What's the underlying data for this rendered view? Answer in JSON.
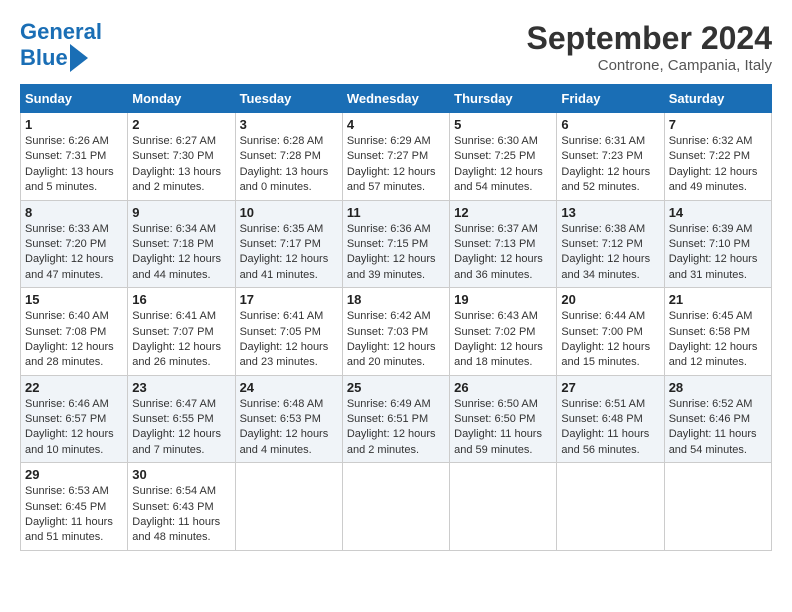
{
  "header": {
    "logo_line1": "General",
    "logo_line2": "Blue",
    "month": "September 2024",
    "location": "Controne, Campania, Italy"
  },
  "weekdays": [
    "Sunday",
    "Monday",
    "Tuesday",
    "Wednesday",
    "Thursday",
    "Friday",
    "Saturday"
  ],
  "weeks": [
    [
      {
        "day": "1",
        "lines": [
          "Sunrise: 6:26 AM",
          "Sunset: 7:31 PM",
          "Daylight: 13 hours",
          "and 5 minutes."
        ]
      },
      {
        "day": "2",
        "lines": [
          "Sunrise: 6:27 AM",
          "Sunset: 7:30 PM",
          "Daylight: 13 hours",
          "and 2 minutes."
        ]
      },
      {
        "day": "3",
        "lines": [
          "Sunrise: 6:28 AM",
          "Sunset: 7:28 PM",
          "Daylight: 13 hours",
          "and 0 minutes."
        ]
      },
      {
        "day": "4",
        "lines": [
          "Sunrise: 6:29 AM",
          "Sunset: 7:27 PM",
          "Daylight: 12 hours",
          "and 57 minutes."
        ]
      },
      {
        "day": "5",
        "lines": [
          "Sunrise: 6:30 AM",
          "Sunset: 7:25 PM",
          "Daylight: 12 hours",
          "and 54 minutes."
        ]
      },
      {
        "day": "6",
        "lines": [
          "Sunrise: 6:31 AM",
          "Sunset: 7:23 PM",
          "Daylight: 12 hours",
          "and 52 minutes."
        ]
      },
      {
        "day": "7",
        "lines": [
          "Sunrise: 6:32 AM",
          "Sunset: 7:22 PM",
          "Daylight: 12 hours",
          "and 49 minutes."
        ]
      }
    ],
    [
      {
        "day": "8",
        "lines": [
          "Sunrise: 6:33 AM",
          "Sunset: 7:20 PM",
          "Daylight: 12 hours",
          "and 47 minutes."
        ]
      },
      {
        "day": "9",
        "lines": [
          "Sunrise: 6:34 AM",
          "Sunset: 7:18 PM",
          "Daylight: 12 hours",
          "and 44 minutes."
        ]
      },
      {
        "day": "10",
        "lines": [
          "Sunrise: 6:35 AM",
          "Sunset: 7:17 PM",
          "Daylight: 12 hours",
          "and 41 minutes."
        ]
      },
      {
        "day": "11",
        "lines": [
          "Sunrise: 6:36 AM",
          "Sunset: 7:15 PM",
          "Daylight: 12 hours",
          "and 39 minutes."
        ]
      },
      {
        "day": "12",
        "lines": [
          "Sunrise: 6:37 AM",
          "Sunset: 7:13 PM",
          "Daylight: 12 hours",
          "and 36 minutes."
        ]
      },
      {
        "day": "13",
        "lines": [
          "Sunrise: 6:38 AM",
          "Sunset: 7:12 PM",
          "Daylight: 12 hours",
          "and 34 minutes."
        ]
      },
      {
        "day": "14",
        "lines": [
          "Sunrise: 6:39 AM",
          "Sunset: 7:10 PM",
          "Daylight: 12 hours",
          "and 31 minutes."
        ]
      }
    ],
    [
      {
        "day": "15",
        "lines": [
          "Sunrise: 6:40 AM",
          "Sunset: 7:08 PM",
          "Daylight: 12 hours",
          "and 28 minutes."
        ]
      },
      {
        "day": "16",
        "lines": [
          "Sunrise: 6:41 AM",
          "Sunset: 7:07 PM",
          "Daylight: 12 hours",
          "and 26 minutes."
        ]
      },
      {
        "day": "17",
        "lines": [
          "Sunrise: 6:41 AM",
          "Sunset: 7:05 PM",
          "Daylight: 12 hours",
          "and 23 minutes."
        ]
      },
      {
        "day": "18",
        "lines": [
          "Sunrise: 6:42 AM",
          "Sunset: 7:03 PM",
          "Daylight: 12 hours",
          "and 20 minutes."
        ]
      },
      {
        "day": "19",
        "lines": [
          "Sunrise: 6:43 AM",
          "Sunset: 7:02 PM",
          "Daylight: 12 hours",
          "and 18 minutes."
        ]
      },
      {
        "day": "20",
        "lines": [
          "Sunrise: 6:44 AM",
          "Sunset: 7:00 PM",
          "Daylight: 12 hours",
          "and 15 minutes."
        ]
      },
      {
        "day": "21",
        "lines": [
          "Sunrise: 6:45 AM",
          "Sunset: 6:58 PM",
          "Daylight: 12 hours",
          "and 12 minutes."
        ]
      }
    ],
    [
      {
        "day": "22",
        "lines": [
          "Sunrise: 6:46 AM",
          "Sunset: 6:57 PM",
          "Daylight: 12 hours",
          "and 10 minutes."
        ]
      },
      {
        "day": "23",
        "lines": [
          "Sunrise: 6:47 AM",
          "Sunset: 6:55 PM",
          "Daylight: 12 hours",
          "and 7 minutes."
        ]
      },
      {
        "day": "24",
        "lines": [
          "Sunrise: 6:48 AM",
          "Sunset: 6:53 PM",
          "Daylight: 12 hours",
          "and 4 minutes."
        ]
      },
      {
        "day": "25",
        "lines": [
          "Sunrise: 6:49 AM",
          "Sunset: 6:51 PM",
          "Daylight: 12 hours",
          "and 2 minutes."
        ]
      },
      {
        "day": "26",
        "lines": [
          "Sunrise: 6:50 AM",
          "Sunset: 6:50 PM",
          "Daylight: 11 hours",
          "and 59 minutes."
        ]
      },
      {
        "day": "27",
        "lines": [
          "Sunrise: 6:51 AM",
          "Sunset: 6:48 PM",
          "Daylight: 11 hours",
          "and 56 minutes."
        ]
      },
      {
        "day": "28",
        "lines": [
          "Sunrise: 6:52 AM",
          "Sunset: 6:46 PM",
          "Daylight: 11 hours",
          "and 54 minutes."
        ]
      }
    ],
    [
      {
        "day": "29",
        "lines": [
          "Sunrise: 6:53 AM",
          "Sunset: 6:45 PM",
          "Daylight: 11 hours",
          "and 51 minutes."
        ]
      },
      {
        "day": "30",
        "lines": [
          "Sunrise: 6:54 AM",
          "Sunset: 6:43 PM",
          "Daylight: 11 hours",
          "and 48 minutes."
        ]
      },
      {
        "day": "",
        "lines": []
      },
      {
        "day": "",
        "lines": []
      },
      {
        "day": "",
        "lines": []
      },
      {
        "day": "",
        "lines": []
      },
      {
        "day": "",
        "lines": []
      }
    ]
  ]
}
